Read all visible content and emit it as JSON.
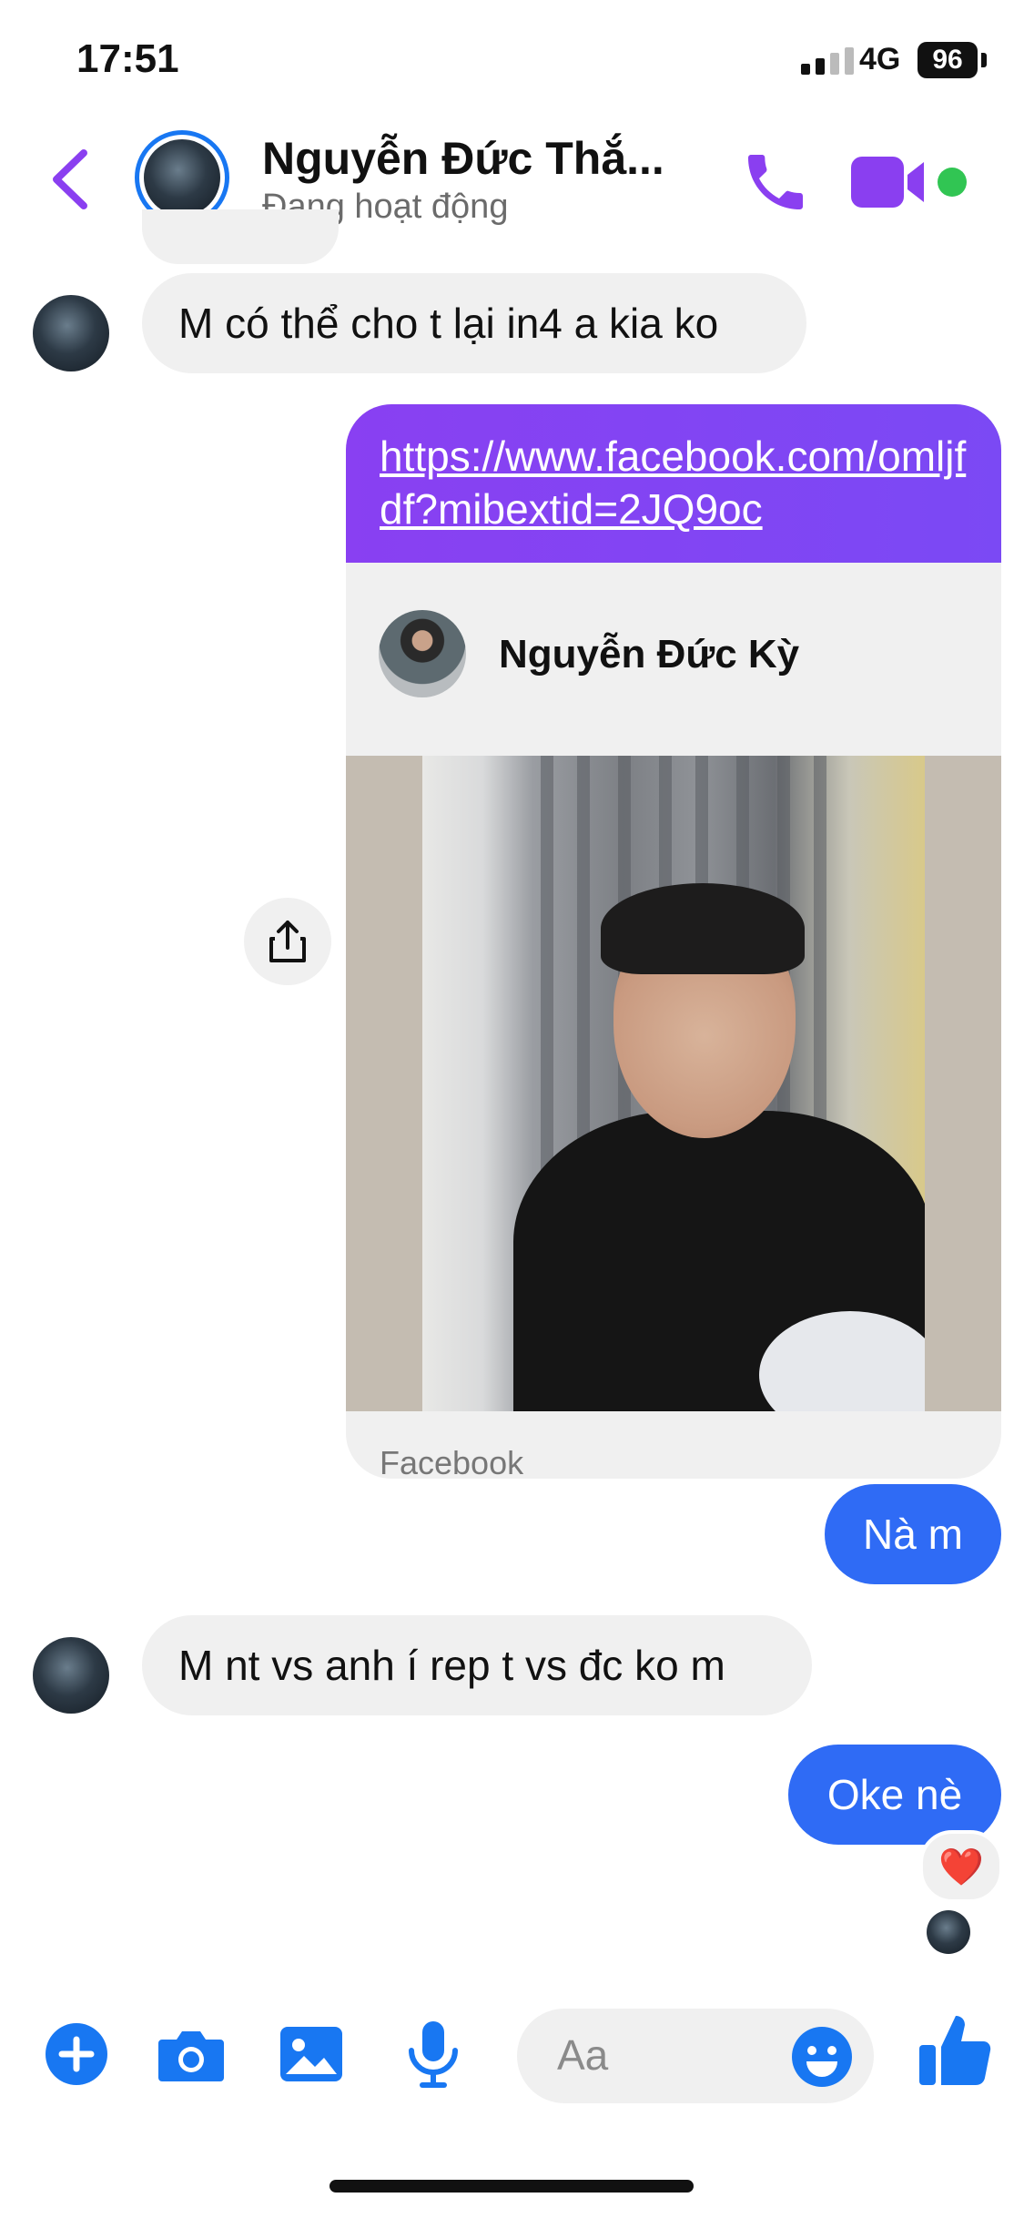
{
  "status_bar": {
    "time": "17:51",
    "network": "4G",
    "battery": "96"
  },
  "header": {
    "contact_name": "Nguyễn Đức Thắ...",
    "status": "Đang hoạt động"
  },
  "messages": {
    "incoming_1": "M có thể cho t lại in4 a kia ko",
    "link_url": "https://www.facebook.com/omljfdf?mibextid=2JQ9oc",
    "link_profile_name": "Nguyễn Đức Kỳ",
    "link_source": "Facebook",
    "outgoing_1": "Nà m",
    "incoming_2": "M nt vs anh í rep t vs đc ko m",
    "outgoing_2": "Oke nè",
    "reaction": "❤️"
  },
  "composer": {
    "placeholder": "Aa"
  },
  "colors": {
    "accent": "#8a3ff0",
    "outgoing": "#2f6bf5",
    "incoming": "#f0f0f0",
    "online": "#31c553"
  }
}
